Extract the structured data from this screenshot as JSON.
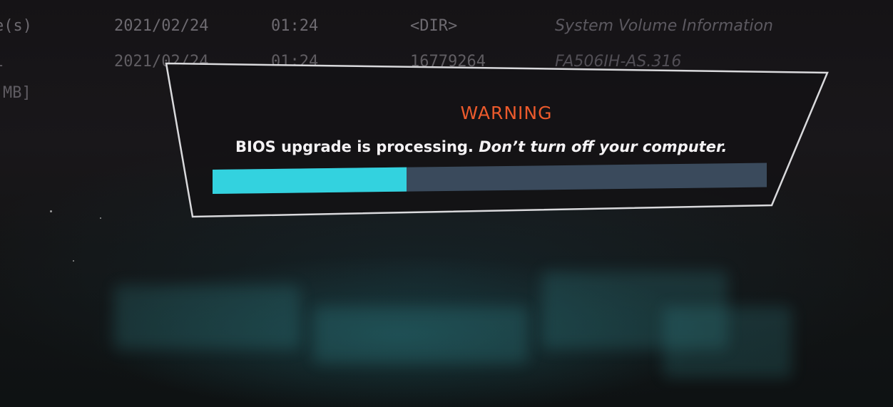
{
  "file_list": {
    "rows": [
      {
        "size": "e(s)",
        "date": "2021/02/24",
        "time": "01:24",
        "type": "<DIR>",
        "name": "System Volume Information"
      },
      {
        "size": "l",
        "date": "2021/02/24",
        "time": "01:24",
        "type": "16779264",
        "name": "FA506IH-AS.316"
      }
    ],
    "side_label": "MB]"
  },
  "dialog": {
    "title": "WARNING",
    "message_part1": "BIOS upgrade is processing.",
    "message_part2": "Don’t turn off your computer.",
    "progress_fraction": 0.35
  },
  "colors": {
    "warning_title": "#ec5a2c",
    "progress_fill": "#33d2df",
    "progress_track": "#3a4a5c",
    "dialog_border": "#d9d9dc"
  }
}
